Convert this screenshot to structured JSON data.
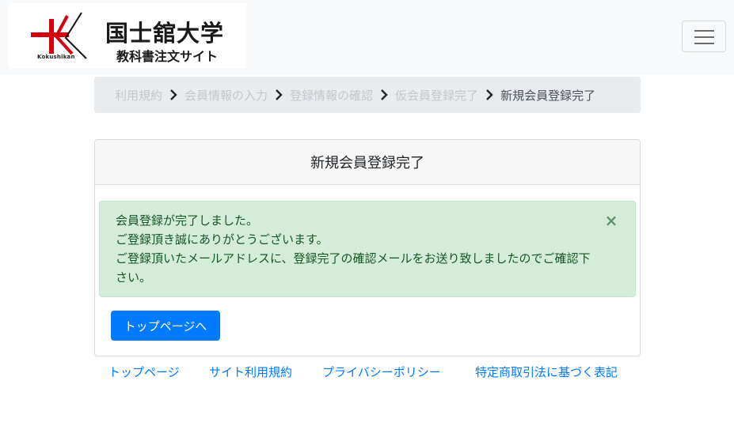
{
  "header": {
    "logo_title": "国士舘大学",
    "logo_subtitle": "教科書注文サイト",
    "logo_roman": "Kokushikan",
    "menu_icon": "hamburger-menu-icon",
    "logo_color": "#d7000f"
  },
  "breadcrumb": {
    "items": [
      "利用規約",
      "会員情報の入力",
      "登録情報の確認",
      "仮会員登録完了",
      "新規会員登録完了"
    ],
    "separator_icon": "chevron-right-icon"
  },
  "card": {
    "title": "新規会員登録完了",
    "alert": {
      "line1": "会員登録が完了しました。",
      "line2": "ご登録頂き誠にありがとうございます。",
      "line3": "ご登録頂いたメールアドレスに、登録完了の確認メールをお送り致しましたのでご確認下さい。",
      "close_label": "×",
      "color": "#d4edda"
    },
    "button_label": "トップページへ",
    "button_color": "#007bff"
  },
  "footer": {
    "links": [
      "トップページ",
      "サイト利用規約",
      "プライバシーポリシー",
      "特定商取引法に基づく表記"
    ]
  }
}
